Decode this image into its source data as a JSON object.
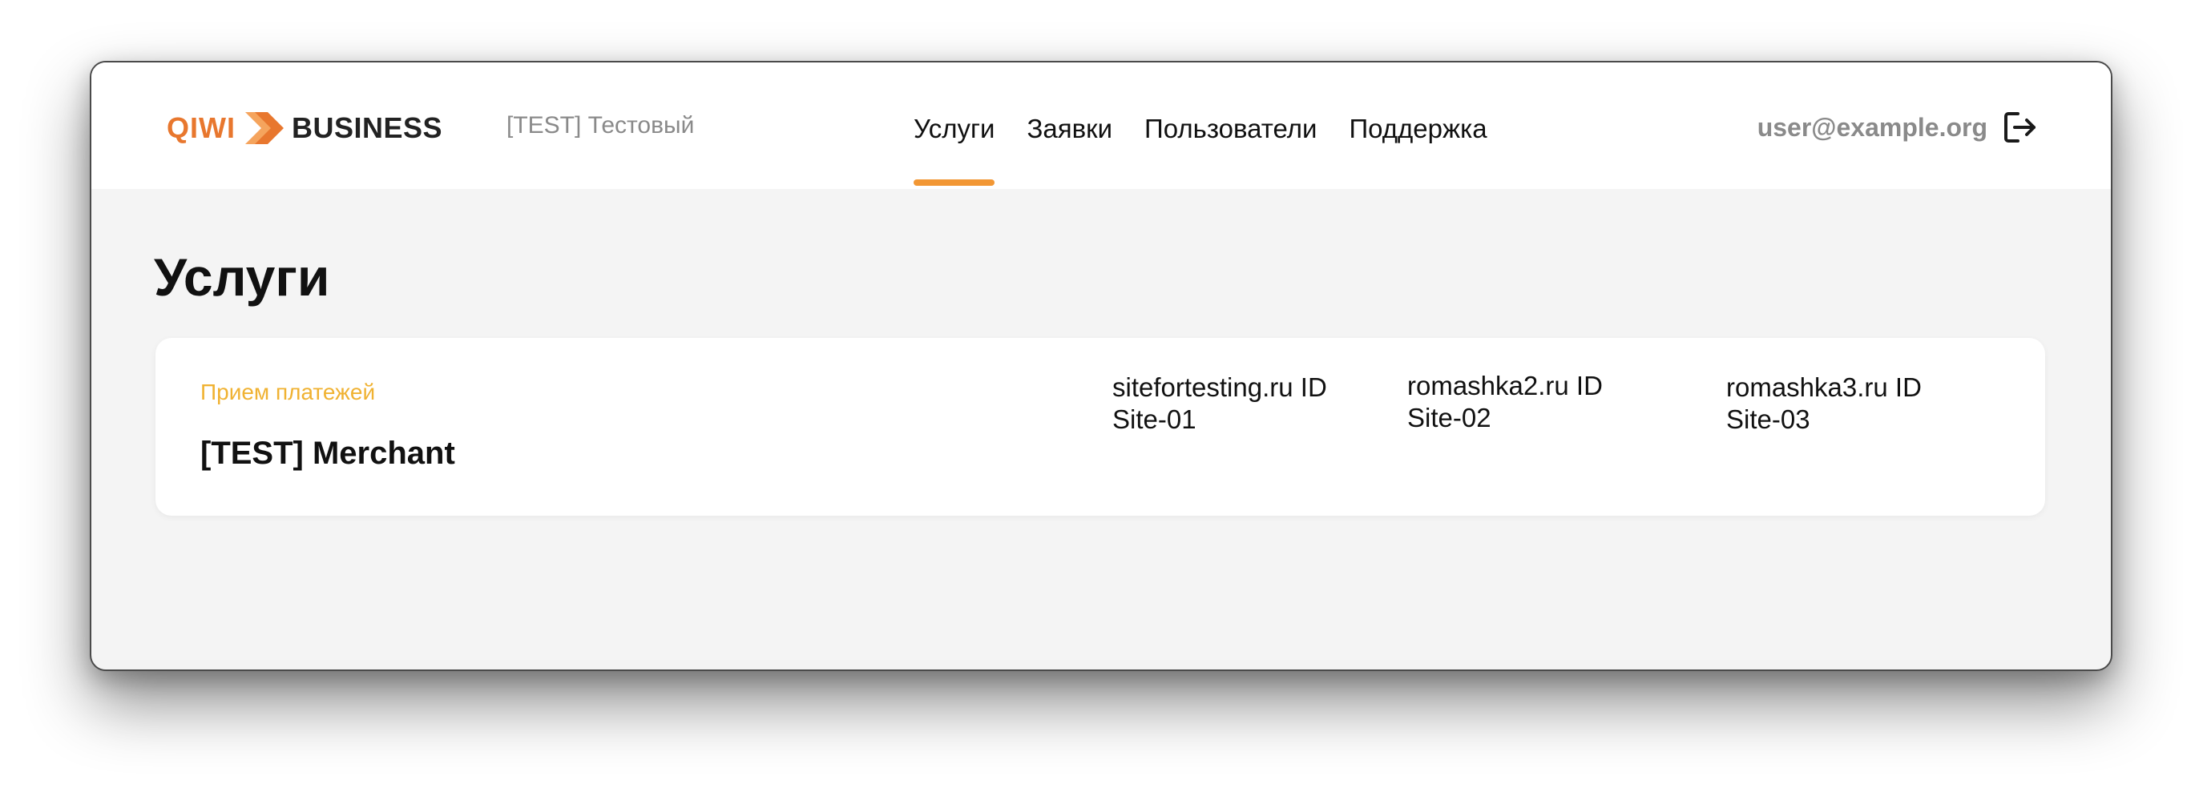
{
  "header": {
    "logo": {
      "qiwi_text": "QIWI",
      "business_text": "BUSINESS",
      "arrow_color": "#e8772e"
    },
    "org_name": "[TEST] Тестовый",
    "nav": [
      {
        "label": "Услуги",
        "active": true
      },
      {
        "label": "Заявки",
        "active": false
      },
      {
        "label": "Пользователи",
        "active": false
      },
      {
        "label": "Поддержка",
        "active": false
      }
    ],
    "user_email": "user@example.org",
    "logout_icon": "logout-icon"
  },
  "page": {
    "title": "Услуги"
  },
  "service_card": {
    "category": "Прием платежей",
    "title": "[TEST] Merchant",
    "sites": [
      {
        "name": "sitefortesting.ru ID",
        "id": "Site-01"
      },
      {
        "name": "romashka2.ru ID",
        "id": "Site-02"
      },
      {
        "name": "romashka3.ru ID",
        "id": "Site-03"
      }
    ]
  },
  "colors": {
    "accent": "#f29734",
    "category": "#f0b232",
    "background": "#f4f4f4"
  }
}
